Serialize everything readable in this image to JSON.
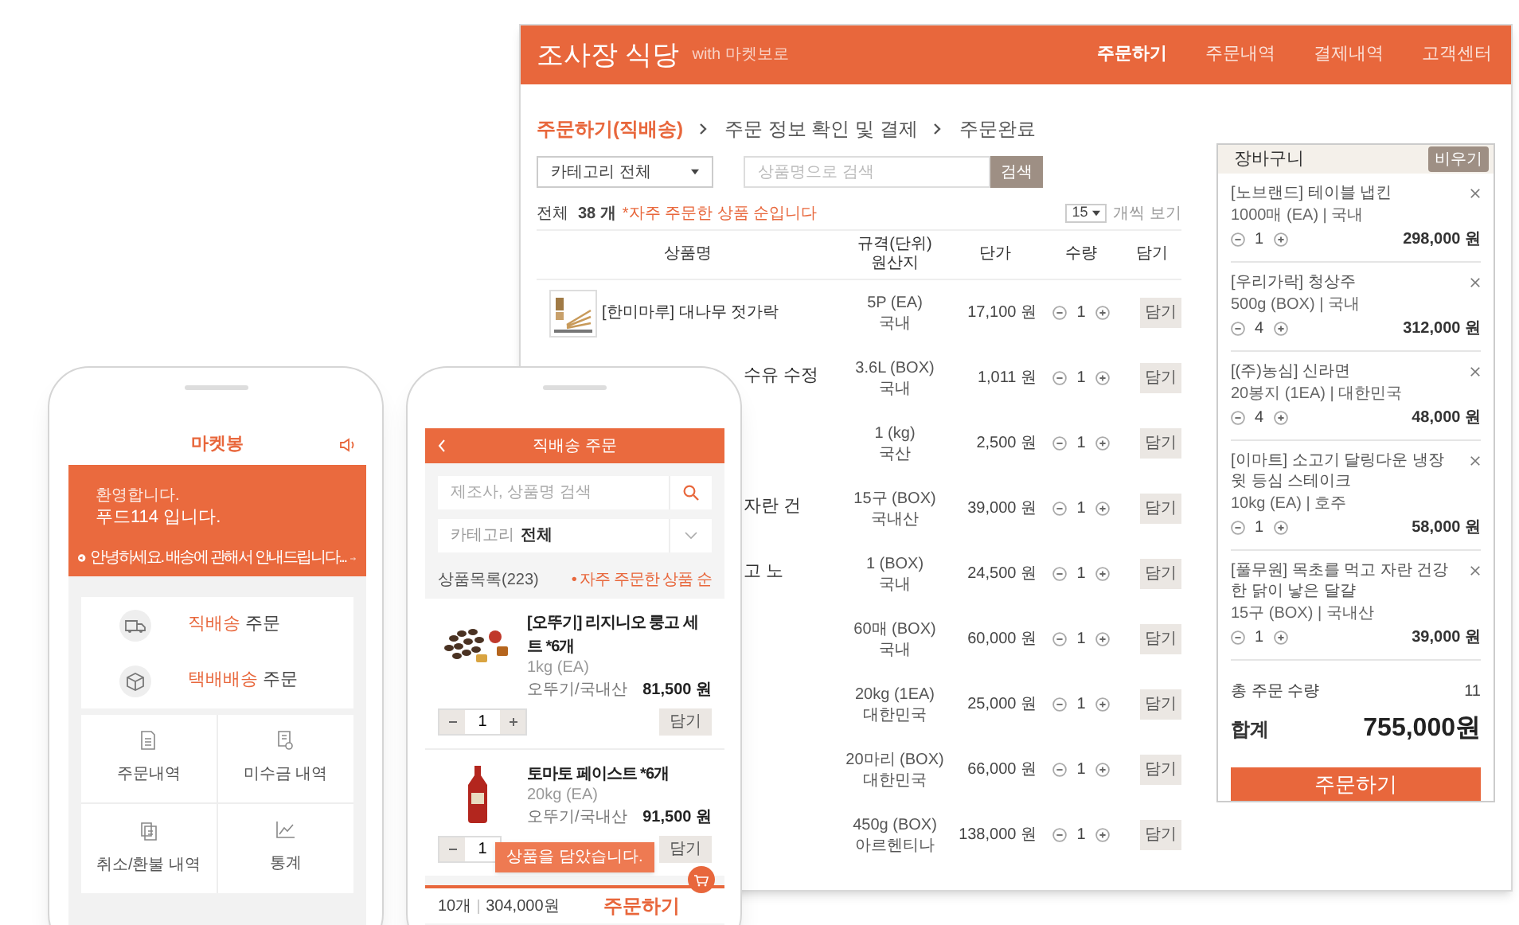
{
  "web": {
    "brand": "조사장 식당",
    "brand_sub": "with 마켓보로",
    "nav": [
      {
        "label": "주문하기",
        "selected": true
      },
      {
        "label": "주문내역",
        "selected": false
      },
      {
        "label": "결제내역",
        "selected": false
      },
      {
        "label": "고객센터",
        "selected": false
      }
    ],
    "steps": [
      {
        "label": "주문하기(직배송)",
        "selected": true
      },
      {
        "label": "주문 정보 확인 및 결제",
        "selected": false
      },
      {
        "label": "주문완료",
        "selected": false
      }
    ],
    "category_select": "카테고리 전체",
    "search": {
      "placeholder": "상품명으로 검색",
      "button": "검색"
    },
    "count": {
      "label": "전체",
      "value": "38 개",
      "note": "*자주 주문한 상품 순입니다"
    },
    "page_size": {
      "value": "15",
      "label": "개씩 보기"
    },
    "table": {
      "columns": [
        {
          "label": "상품명"
        },
        {
          "label": "규격(단위)",
          "line_2": "원산지"
        },
        {
          "label": "단가"
        },
        {
          "label": "수량"
        },
        {
          "label": "담기"
        }
      ],
      "rows": [
        {
          "name": "[한미마루] 대나무 젓가락",
          "image": true,
          "spec": "5P (EA)",
          "origin": "국내",
          "price": "17,100 원",
          "qty": "1",
          "add": "담기"
        },
        {
          "name": "수유 수정",
          "spec": "3.6L (BOX)",
          "origin": "국내",
          "price": "1,011 원",
          "qty": "1",
          "add": "담기"
        },
        {
          "spec": "1 (kg)",
          "origin": "국산",
          "price": "2,500 원",
          "qty": "1",
          "add": "담기"
        },
        {
          "name": "자란 건",
          "spec": "15구 (BOX)",
          "origin": "국내산",
          "price": "39,000 원",
          "qty": "1",
          "add": "담기"
        },
        {
          "name": "고 노",
          "spec": "1 (BOX)",
          "origin": "국내",
          "price": "24,500 원",
          "qty": "1",
          "add": "담기"
        },
        {
          "spec": "60매 (BOX)",
          "origin": "국내",
          "price": "60,000 원",
          "qty": "1",
          "add": "담기"
        },
        {
          "spec": "20kg (1EA)",
          "origin": "대한민국",
          "price": "25,000 원",
          "qty": "1",
          "add": "담기"
        },
        {
          "spec": "20마리 (BOX)",
          "origin": "대한민국",
          "price": "66,000 원",
          "qty": "1",
          "add": "담기"
        },
        {
          "spec": "450g (BOX)",
          "origin": "아르헨티나",
          "price": "138,000 원",
          "qty": "1",
          "add": "담기"
        }
      ]
    },
    "cart": {
      "title": "장바구니",
      "clear_button": "비우기",
      "items": [
        {
          "name": "[노브랜드] 테이블 냅킨",
          "spec": "1000매 (EA) | 국내",
          "qty": "1",
          "total": "298,000 원"
        },
        {
          "name": "[우리가락] 청상주",
          "spec": "500g (BOX) | 국내",
          "qty": "4",
          "total": "312,000 원"
        },
        {
          "name": "[(주)농심] 신라면",
          "spec": "20봉지 (1EA) | 대한민국",
          "qty": "4",
          "total": "48,000 원"
        },
        {
          "name": "[이마트] 소고기 달링다운 냉장 윗 등심 스테이크",
          "spec": "10kg (EA) | 호주",
          "qty": "1",
          "total": "58,000 원"
        },
        {
          "name": "[풀무원] 목초를 먹고 자란 건강한 닭이 낳은 달걀",
          "spec": "15구 (BOX) | 국내산",
          "qty": "1",
          "total": "39,000 원"
        }
      ],
      "total_qty_label": "총 주문 수량",
      "total_qty": "11",
      "sum_label": "합계",
      "sum": "755,000원",
      "order_button": "주문하기"
    }
  },
  "phone_home": {
    "title": "마켓봉",
    "greeting": "환영합니다.",
    "name_line": "푸드114 입니다.",
    "notice": "안녕하세요. 배송에 관해서 안내드립니다...",
    "order_menu": [
      {
        "kind": "truck",
        "accent": "직배송",
        "label": "주문"
      },
      {
        "kind": "box",
        "accent": "택배배송",
        "label": "주문"
      }
    ],
    "menu": [
      {
        "kind": "doc",
        "label": "주문내역"
      },
      {
        "kind": "coin",
        "label": "미수금 내역"
      },
      {
        "kind": "refund",
        "label": "취소/환불 내역"
      },
      {
        "kind": "chart",
        "label": "통계"
      }
    ]
  },
  "phone_order": {
    "title": "직배송 주문",
    "search_placeholder": "제조사, 상품명 검색",
    "category_label": "카테고리",
    "category_value": "전체",
    "list_title": "상품목록(223)",
    "sort": "• 자주 주문한 상품 순",
    "products": [
      {
        "kind": "beans",
        "name": "[오뚜기] 리지니오 룽고 세트 *6개",
        "spec": "1kg (EA)",
        "maker": "오뚜기/국내산",
        "price": "81,500 원",
        "qty": "1",
        "add": "담기"
      },
      {
        "kind": "bottle",
        "name": "토마토 페이스트 *6개",
        "spec": "20kg (EA)",
        "maker": "오뚜기/국내산",
        "price": "91,500 원",
        "qty": "1",
        "add": "담기"
      }
    ],
    "toast": "상품을 담았습니다.",
    "bottom": {
      "count": "10개",
      "sum": "304,000원",
      "order": "주문하기"
    }
  }
}
